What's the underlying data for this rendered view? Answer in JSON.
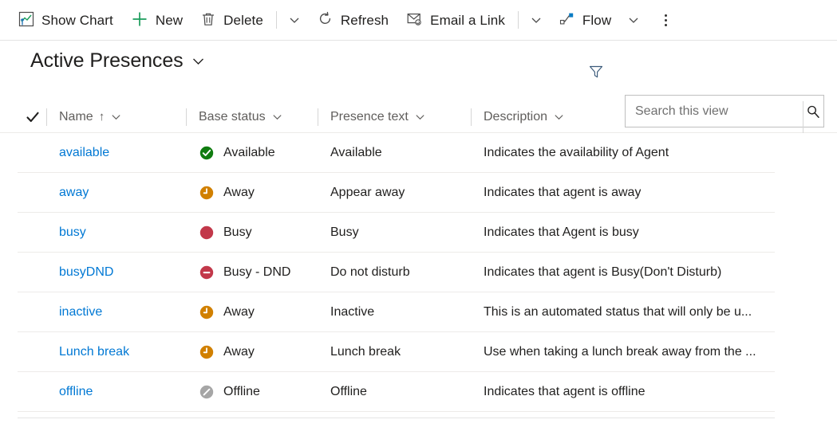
{
  "command_bar": {
    "items": [
      {
        "id": "show-chart",
        "label": "Show Chart",
        "icon": "chart-icon"
      },
      {
        "id": "new",
        "label": "New",
        "icon": "plus-icon"
      },
      {
        "id": "delete",
        "label": "Delete",
        "icon": "trash-icon"
      },
      {
        "id": "refresh",
        "label": "Refresh",
        "icon": "refresh-icon"
      },
      {
        "id": "email-a-link",
        "label": "Email a Link",
        "icon": "envelope-link-icon"
      },
      {
        "id": "flow",
        "label": "Flow",
        "icon": "flow-icon"
      }
    ],
    "overflow_label": "More commands"
  },
  "view": {
    "title": "Active Presences",
    "title_chevron": "chevron-down-icon",
    "filter_icon": "filter-icon"
  },
  "search": {
    "placeholder": "Search this view",
    "value": "",
    "icon": "search-icon"
  },
  "grid": {
    "select_all_icon": "checkmark-icon",
    "columns": [
      {
        "key": "name",
        "label": "Name",
        "sorted": true,
        "sort_arrow": "↑"
      },
      {
        "key": "base_status",
        "label": "Base status",
        "sorted": false
      },
      {
        "key": "presence_text",
        "label": "Presence text",
        "sorted": false
      },
      {
        "key": "description",
        "label": "Description",
        "sorted": false
      }
    ],
    "rows": [
      {
        "name": "available",
        "base_status": "Available",
        "status_icon": "available-check-icon",
        "status_color": "#107c10",
        "presence_text": "Available",
        "description": "Indicates the availability of Agent"
      },
      {
        "name": "away",
        "base_status": "Away",
        "status_icon": "away-clock-icon",
        "status_color": "#d18000",
        "presence_text": "Appear away",
        "description": "Indicates that agent is away"
      },
      {
        "name": "busy",
        "base_status": "Busy",
        "status_icon": "busy-circle-icon",
        "status_color": "#c2384a",
        "presence_text": "Busy",
        "description": "Indicates that Agent is busy"
      },
      {
        "name": "busyDND",
        "base_status": "Busy - DND",
        "status_icon": "dnd-minus-icon",
        "status_color": "#c2384a",
        "presence_text": "Do not disturb",
        "description": "Indicates that agent is Busy(Don't Disturb)"
      },
      {
        "name": "inactive",
        "base_status": "Away",
        "status_icon": "away-clock-icon",
        "status_color": "#d18000",
        "presence_text": "Inactive",
        "description": "This is an automated status that will only be u..."
      },
      {
        "name": "Lunch break",
        "base_status": "Away",
        "status_icon": "away-clock-icon",
        "status_color": "#d18000",
        "presence_text": "Lunch break",
        "description": "Use when taking a lunch break away from the ..."
      },
      {
        "name": "offline",
        "base_status": "Offline",
        "status_icon": "offline-slash-icon",
        "status_color": "#a6a6a6",
        "presence_text": "Offline",
        "description": "Indicates that agent is offline"
      }
    ]
  },
  "colors": {
    "link": "#0078d4",
    "available": "#107c10",
    "away": "#d18000",
    "busy": "#c2384a",
    "offline": "#a6a6a6",
    "text": "#201f1e",
    "muted": "#605e5c"
  }
}
